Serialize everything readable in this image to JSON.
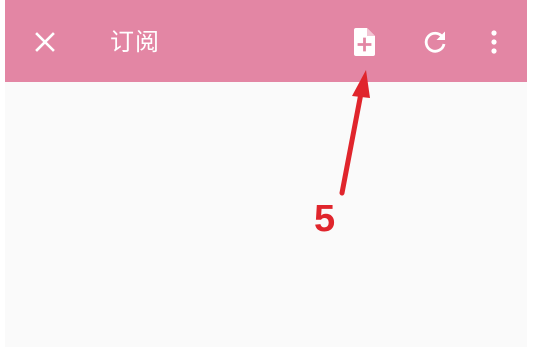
{
  "appbar": {
    "title": "订阅",
    "background_color": "#e386a4",
    "close_icon": "close-icon",
    "actions": [
      {
        "icon": "add-file-icon"
      },
      {
        "icon": "refresh-icon"
      },
      {
        "icon": "more-vertical-icon"
      }
    ]
  },
  "annotation": {
    "step_number": "5",
    "color": "#e0252c",
    "points_to": "add-file-icon"
  },
  "content": {
    "background_color": "#fafafa"
  }
}
